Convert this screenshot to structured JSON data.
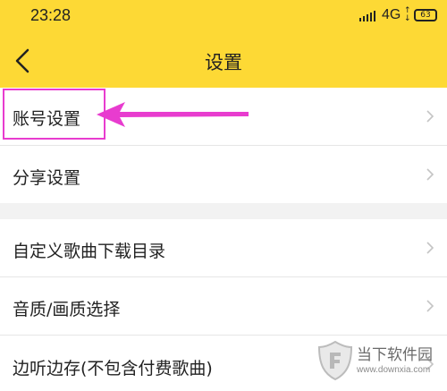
{
  "status_bar": {
    "time": "23:28",
    "network": "4G",
    "battery": "63"
  },
  "header": {
    "title": "设置",
    "back_icon": "chevron-left-icon"
  },
  "settings": {
    "items": [
      {
        "label": "账号设置",
        "icon": "chevron-right-icon"
      },
      {
        "label": "分享设置",
        "icon": "chevron-right-icon"
      },
      {
        "label": "自定义歌曲下载目录",
        "icon": "chevron-right-icon"
      },
      {
        "label": "音质/画质选择",
        "icon": "chevron-right-icon"
      },
      {
        "label": "边听边存(不包含付费歌曲)",
        "icon": "chevron-right-icon"
      }
    ]
  },
  "annotation": {
    "color": "#e83ccf",
    "target": "账号设置"
  },
  "watermark": {
    "name": "当下软件园",
    "url": "www.downxia.com"
  },
  "colors": {
    "header_bg": "#fdd935",
    "page_bg": "#f2f2f2",
    "row_bg": "#ffffff",
    "accent": "#e83ccf"
  }
}
